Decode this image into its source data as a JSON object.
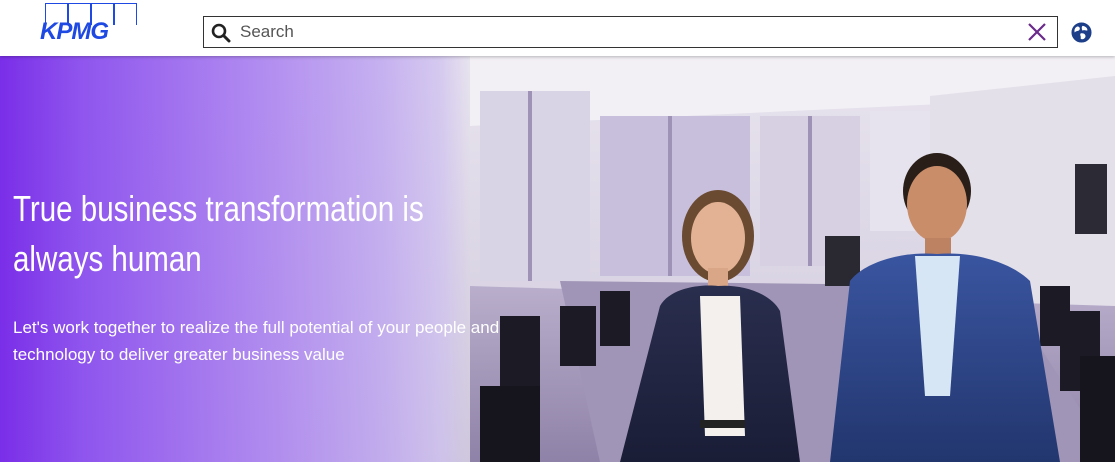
{
  "header": {
    "logo_text": "KPMG",
    "search": {
      "placeholder": "Search",
      "value": ""
    },
    "icons": {
      "search": "search-icon",
      "clear": "close-icon",
      "language": "globe-icon"
    }
  },
  "hero": {
    "title": "True business transformation is\nalways human",
    "subtitle": "Let's work together to realize the full potential of your people and technology to deliver greater business value",
    "image_alt": "Two professionals standing in a conference room"
  },
  "colors": {
    "brand_blue": "#1e49e2",
    "hero_purple": "#7a2ee8",
    "clear_icon": "#6a2a8a"
  }
}
